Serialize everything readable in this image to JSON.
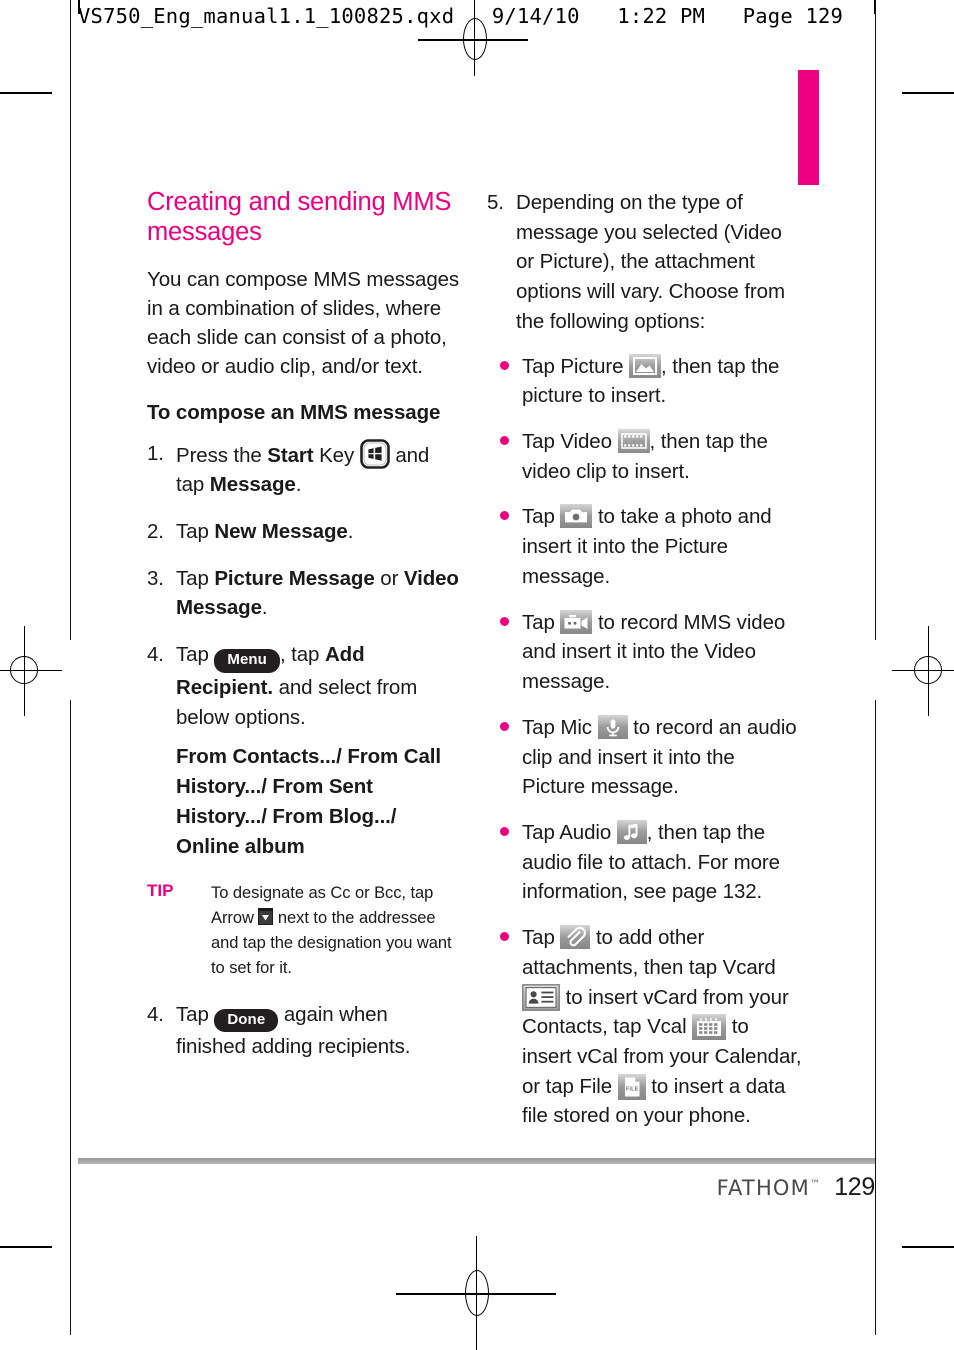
{
  "prepress": {
    "header_line": "VS750_Eng_manual1.1_100825.qxd   9/14/10   1:22 PM   Page 129"
  },
  "accent_color": "#EC0080",
  "left_column": {
    "section_title": "Creating and sending MMS messages",
    "intro": "You can compose MMS messages in a combination of slides, where each slide can consist of a photo, video or audio clip, and/or text.",
    "subheading": "To compose an MMS message",
    "steps": [
      {
        "num": "1.",
        "pre": "Press the ",
        "bold1": "Start",
        "mid": " Key ",
        "icon": "start-key-icon",
        "post": " and tap ",
        "bold2": "Message",
        "tail": "."
      },
      {
        "num": "2.",
        "pre": "Tap ",
        "bold1": "New Message",
        "tail": "."
      },
      {
        "num": "3.",
        "pre": "Tap ",
        "bold1": "Picture Message",
        "mid": " or ",
        "bold2": "Video Message",
        "tail": "."
      },
      {
        "num": "4.",
        "pre": "Tap ",
        "chip": "Menu",
        "mid": ", tap ",
        "bold1": "Add Recipient.",
        "tail": " and select from below options."
      }
    ],
    "recipient_options": "From Contacts.../ From Call History.../ From Sent History.../ From Blog.../ Online album",
    "tip": {
      "label": "TIP",
      "pre": "To designate as Cc or Bcc, tap Arrow ",
      "icon": "arrow-down-icon",
      "post": " next to the addressee and tap the designation you want to set for it."
    },
    "final_step": {
      "num": "4.",
      "pre": "Tap ",
      "chip": "Done",
      "tail": " again when finished adding recipients."
    }
  },
  "right_column": {
    "step5": {
      "num": "5.",
      "text": "Depending on the type of message you selected (Video or Picture), the attachment options will vary. Choose from the following options:"
    },
    "bullets": [
      {
        "pre": "Tap Picture ",
        "icon": "picture-icon",
        "post": ", then tap the picture to insert."
      },
      {
        "pre": "Tap Video ",
        "icon": "video-icon",
        "post": ", then tap the video clip to insert."
      },
      {
        "pre": "Tap ",
        "icon": "camera-icon",
        "post": " to take a photo and insert it into the Picture message."
      },
      {
        "pre": "Tap ",
        "icon": "camcorder-icon",
        "post": " to record MMS video and insert it into the Video message."
      },
      {
        "pre": "Tap Mic ",
        "icon": "microphone-icon",
        "post": " to record an audio clip and insert it into the Picture message."
      },
      {
        "pre": "Tap Audio ",
        "icon": "music-note-icon",
        "post": ", then tap the audio file to attach. For more information, see page 132."
      }
    ],
    "attachment_bullet": {
      "p1": "Tap ",
      "icon1": "paperclip-icon",
      "p2": " to add other attachments, then tap Vcard ",
      "icon2": "vcard-icon",
      "p3": " to insert vCard from your Contacts, tap Vcal ",
      "icon3": "calendar-icon",
      "p4": " to insert vCal from your Calendar, or tap File ",
      "icon4": "file-icon",
      "p5": " to insert a data file stored on your phone."
    }
  },
  "footer": {
    "brand": "FATHOM",
    "trademark": "™",
    "page_number": "129"
  }
}
